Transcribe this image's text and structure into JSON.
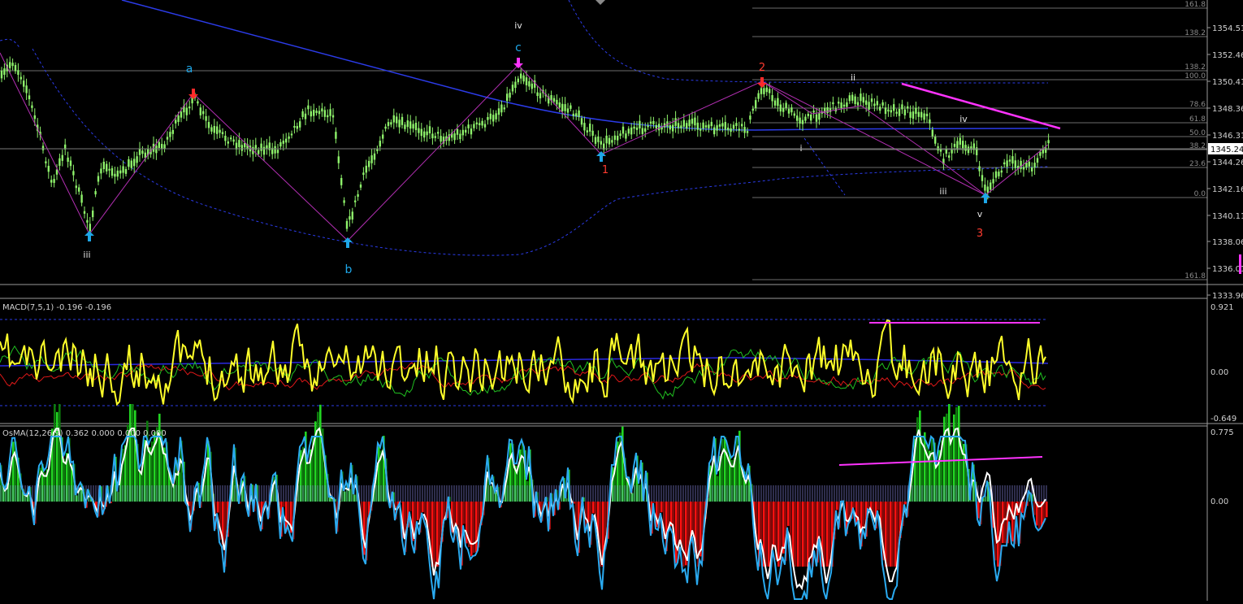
{
  "colors": {
    "background": "#000000",
    "grid": "#6b6b6b",
    "candle": "#8ef26b",
    "ma_blue": "#2b3be8",
    "wave_line": "#b32fb3",
    "trend_magenta": "#ff33ff",
    "label_cyan": "#1ea7e8",
    "label_red": "#ff3b2f",
    "label_white": "#e6e6e6",
    "axis_text": "#d0d0d0",
    "macd_yellow": "#ffff2a",
    "macd_green": "#20c020",
    "macd_red": "#e01818",
    "macd_blue": "#2a2ae0",
    "osma_white": "#ffffff",
    "osma_cyan": "#2aaaf0",
    "osma_green": "#22d522",
    "osma_darkgreen": "#0c7a0c",
    "osma_red": "#ff1010",
    "osma_darkred": "#8a0a0a",
    "osma_hatch": "#9a98ff"
  },
  "price_axis": {
    "ticks": [
      "1354.51",
      "1352.46",
      "1350.41",
      "1348.36",
      "1346.31",
      "1344.26",
      "1342.16",
      "1340.11",
      "1338.06",
      "1336.01",
      "1333.96"
    ],
    "current_price": "1345.24"
  },
  "fib_levels": [
    "161.8",
    "138.2",
    "138.2",
    "100.0",
    "78.6",
    "61.8",
    "50.0",
    "38.2",
    "23.6",
    "0.0",
    "161.8"
  ],
  "wave_labels": [
    {
      "text": "a",
      "color": "cyan"
    },
    {
      "text": "b",
      "color": "cyan"
    },
    {
      "text": "c",
      "color": "cyan"
    },
    {
      "text": "iv",
      "color": "white"
    },
    {
      "text": "iii",
      "color": "white"
    },
    {
      "text": "1",
      "color": "red"
    },
    {
      "text": "2",
      "color": "red"
    },
    {
      "text": "3",
      "color": "red"
    },
    {
      "text": "i",
      "color": "white"
    },
    {
      "text": "ii",
      "color": "white"
    },
    {
      "text": "iii",
      "color": "white"
    },
    {
      "text": "iv",
      "color": "white"
    },
    {
      "text": "v",
      "color": "white"
    }
  ],
  "macd_panel": {
    "label": "MACD(7,5,1) -0.196 -0.196",
    "ticks": [
      "0.921",
      "0.00",
      "-0.649"
    ]
  },
  "osma_panel": {
    "label": "OsMA(12,26,9) 0.362 0.000 0.000 0.000",
    "ticks": [
      "0.775",
      "0.00"
    ]
  },
  "chart_data": {
    "type": "candlestick",
    "title": "",
    "ylim": [
      1333.96,
      1356.5
    ],
    "panels": [
      "price",
      "MACD(7,5,1)",
      "OsMA(12,26,9)"
    ],
    "current_price": 1345.24,
    "wave_pivots": [
      {
        "label": "iii",
        "price": 1338.9
      },
      {
        "label": "a",
        "price": 1349.3
      },
      {
        "label": "b",
        "price": 1338.4
      },
      {
        "label": "c / iv",
        "price": 1351.0
      },
      {
        "label": "1",
        "price": 1345.0
      },
      {
        "label": "2",
        "price": 1349.9
      },
      {
        "label": "v / 3",
        "price": 1342.1
      }
    ]
  }
}
